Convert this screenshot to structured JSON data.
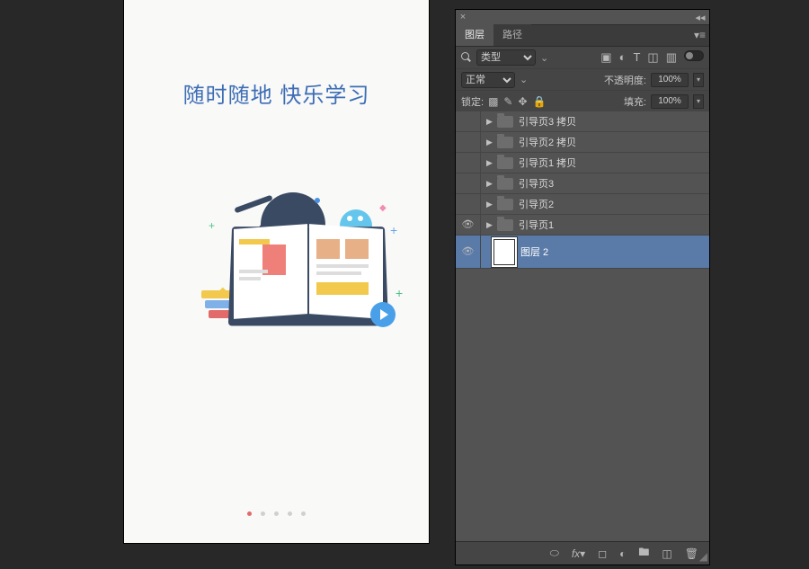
{
  "canvas": {
    "title": "随时随地 快乐学习"
  },
  "panel": {
    "tabs": {
      "layers": "图层",
      "paths": "路径"
    },
    "filter": {
      "placeholder": "类型"
    },
    "blend": {
      "mode": "正常",
      "opacity_label": "不透明度:",
      "opacity_value": "100%"
    },
    "lock": {
      "label": "锁定:",
      "fill_label": "填充:",
      "fill_value": "100%"
    },
    "layers": [
      {
        "name": "引导页3 拷贝",
        "visible": false,
        "type": "group"
      },
      {
        "name": "引导页2 拷贝",
        "visible": false,
        "type": "group"
      },
      {
        "name": "引导页1 拷贝",
        "visible": false,
        "type": "group"
      },
      {
        "name": "引导页3",
        "visible": false,
        "type": "group"
      },
      {
        "name": "引导页2",
        "visible": false,
        "type": "group"
      },
      {
        "name": "引导页1",
        "visible": true,
        "type": "group"
      },
      {
        "name": "图层 2",
        "visible": true,
        "type": "raster",
        "selected": true
      }
    ]
  }
}
